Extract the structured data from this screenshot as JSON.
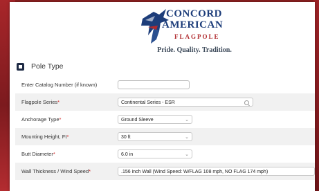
{
  "logo": {
    "line1": "CONCORD",
    "line2": "AMERICAN",
    "line3": "FLAGPOLE",
    "tagline": "Pride. Quality. Tradition."
  },
  "section": {
    "title": "Pole Type"
  },
  "fields": [
    {
      "label": "Enter Catalog Number (if known)",
      "required": "",
      "value": ""
    },
    {
      "label": "Flagpole Series",
      "required": "*",
      "value": "Continental Series - ESR"
    },
    {
      "label": "Anchorage Type",
      "required": "*",
      "value": "Ground Sleeve"
    },
    {
      "label": "Mounting Height, Ft",
      "required": "*",
      "value": "30 ft"
    },
    {
      "label": "Butt Diameter",
      "required": "*",
      "value": "6.0 in"
    },
    {
      "label": "Wall Thickness / Wind Speed",
      "required": "*",
      "value": ".156 inch Wall (Wind Speed: W/FLAG 108 mph, NO FLAG 174 mph)"
    }
  ],
  "icons": {
    "section": "cube-icon",
    "search": "search-icon",
    "dropdown": "chevron-down-icon"
  },
  "colors": {
    "brand_blue": "#1d3d7a",
    "brand_red": "#b02a2e",
    "required": "#d21f1f"
  }
}
